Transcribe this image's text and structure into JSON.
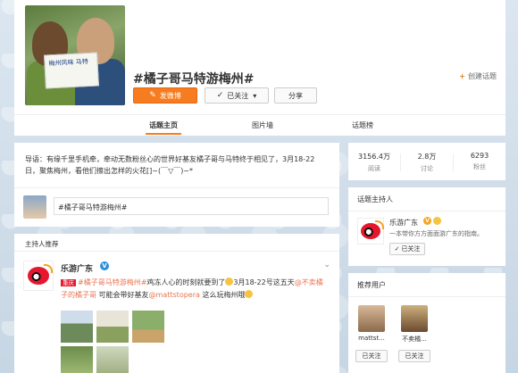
{
  "topic": {
    "title": "#橘子哥马特游梅州#",
    "create_label": "创建话题",
    "sign_text": "梅州风味 马特",
    "post_button": "发微博",
    "follow_button": "已关注",
    "share_button": "分享"
  },
  "tabs": [
    "话题主页",
    "图片墙",
    "话题榜"
  ],
  "guide": {
    "text": "导语：有缘千里手机牵，牵动无数粉丝心的世界好基友橘子哥与马特终于相见了，3月18-22日，聚焦梅州，看他们擦出怎样的火花[]~(￣▽￣)~*"
  },
  "compose": {
    "input_value": "#橘子哥马特游梅州#"
  },
  "host_section": {
    "label": "主持人推荐"
  },
  "post": {
    "author": "乐游广东",
    "verified_mark": "V",
    "more": "⌄",
    "tag": "重庆",
    "segment1": "#橘子哥马特游梅州#",
    "segment2": "鸡冻人心的时刻就要到了",
    "segment3": "3月18-22号这五天",
    "segment4": "@不卖橘子的橘子哥",
    "segment5": " 可能会带好基友",
    "segment6": "@mattstopera",
    "segment7": " 这么玩梅州哦"
  },
  "stats": [
    {
      "num": "3156.4万",
      "label": "阅读"
    },
    {
      "num": "2.8万",
      "label": "讨论"
    },
    {
      "num": "6293",
      "label": "粉丝"
    }
  ],
  "host_card": {
    "title": "话题主持人",
    "name": "乐游广东",
    "verified_mark": "V",
    "desc": "一本带你方方面面游广东的指南。",
    "follow_label": "已关注"
  },
  "recommend": {
    "title": "推荐用户",
    "users": [
      {
        "name": "mattst...",
        "button": "已关注"
      },
      {
        "name": "不卖橘...",
        "button": "已关注"
      }
    ]
  },
  "colors": {
    "accent": "#f77c1f",
    "link": "#eb7350",
    "verified": "#2b8fd8"
  }
}
